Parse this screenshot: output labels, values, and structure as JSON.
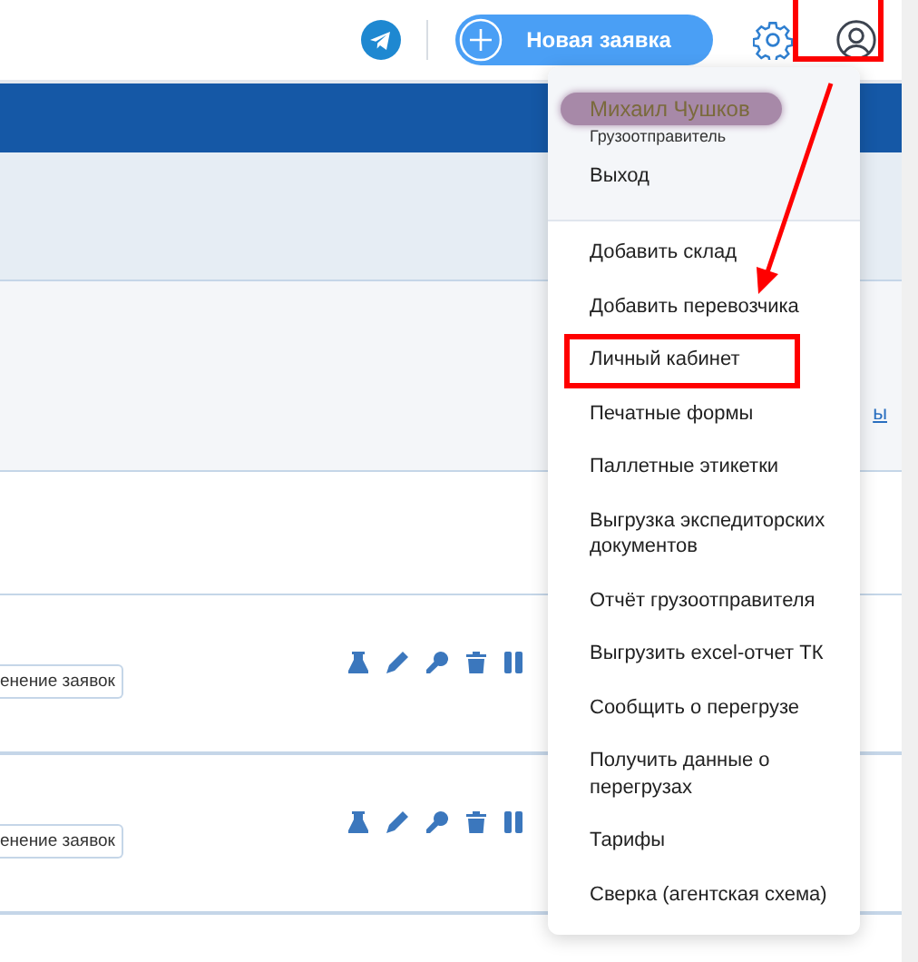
{
  "header": {
    "new_request_button": "Новая заявка",
    "profile_button": {
      "annotated": true
    }
  },
  "filters": {
    "link": "ы"
  },
  "rows": [
    {
      "tag": "енение заявок"
    },
    {
      "tag": "енение заявок"
    }
  ],
  "user_menu": {
    "user": {
      "name": "Михаил Чушков",
      "redacted": true,
      "role": "Грузоотправитель"
    },
    "logout": "Выход",
    "items": [
      {
        "label": "Добавить склад",
        "annotated": false
      },
      {
        "label": "Добавить перевозчика",
        "annotated": false
      },
      {
        "label": "Личный кабинет",
        "annotated": true
      },
      {
        "label": "Печатные формы",
        "annotated": false
      },
      {
        "label": "Паллетные этикетки",
        "annotated": false
      },
      {
        "label": "Выгрузка экспедиторских документов",
        "annotated": false
      },
      {
        "label": "Отчёт грузоотправителя",
        "annotated": false
      },
      {
        "label": "Выгрузить excel-отчет ТК",
        "annotated": false
      },
      {
        "label": "Сообщить о перегрузе",
        "annotated": false
      },
      {
        "label": "Получить данные о перегрузах",
        "annotated": false
      },
      {
        "label": "Тарифы",
        "annotated": false
      },
      {
        "label": "Сверка (агентская схема)",
        "annotated": false
      }
    ]
  },
  "annotation_arrow": true
}
